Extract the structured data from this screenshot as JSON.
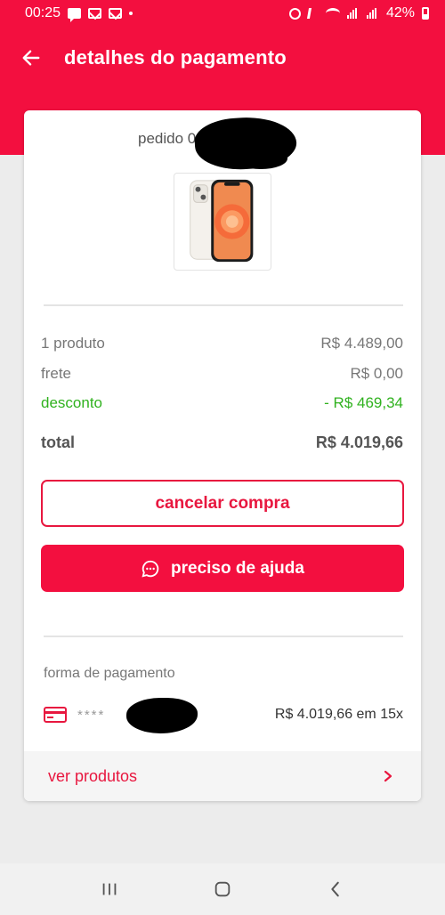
{
  "status_bar": {
    "time": "00:25",
    "battery": "42%"
  },
  "header": {
    "title": "detalhes do pagamento"
  },
  "order": {
    "label": "pedido 0",
    "product_image": "iphone-white"
  },
  "summary": {
    "products_label": "1 produto",
    "products_value": "R$ 4.489,00",
    "shipping_label": "frete",
    "shipping_value": "R$ 0,00",
    "discount_label": "desconto",
    "discount_value": "- R$ 469,34",
    "total_label": "total",
    "total_value": "R$ 4.019,66"
  },
  "actions": {
    "cancel_label": "cancelar compra",
    "help_label": "preciso de ajuda"
  },
  "payment": {
    "section_label": "forma de pagamento",
    "card_masked": "****",
    "amount": "R$ 4.019,66 em 15x"
  },
  "footer_link": {
    "label": "ver produtos"
  },
  "colors": {
    "brand_red": "#f30f3f",
    "discount_green": "#30b21f"
  }
}
